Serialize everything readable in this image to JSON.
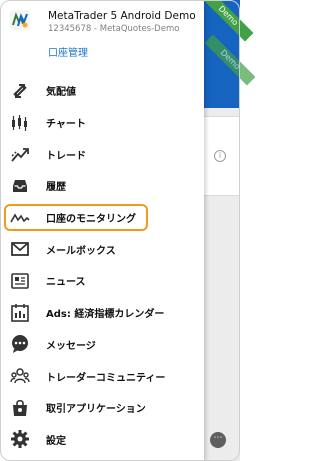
{
  "account": {
    "name": "MetaTrader 5 Android Demo",
    "subtitle": "12345678 - MetaQuotes-Demo",
    "manage_label": "口座管理",
    "badge": "Demo"
  },
  "menu": [
    {
      "label": "気配値",
      "icon": "quotes-icon"
    },
    {
      "label": "チャート",
      "icon": "chart-icon"
    },
    {
      "label": "トレード",
      "icon": "trade-icon"
    },
    {
      "label": "履歴",
      "icon": "history-icon"
    },
    {
      "label": "口座のモニタリング",
      "icon": "monitoring-icon",
      "highlighted": true
    },
    {
      "label": "メールボックス",
      "icon": "mail-icon"
    },
    {
      "label": "ニュース",
      "icon": "news-icon"
    },
    {
      "label": "Ads: 経済指標カレンダー",
      "icon": "calendar-icon"
    },
    {
      "label": "メッセージ",
      "icon": "message-icon"
    },
    {
      "label": "トレーダーコミュニティー",
      "icon": "community-icon"
    },
    {
      "label": "取引アプリケーション",
      "icon": "apps-icon"
    },
    {
      "label": "設定",
      "icon": "settings-icon"
    }
  ],
  "colors": {
    "accent": "#1976d2",
    "highlight": "#f39a1e",
    "badge": "#43a047",
    "icon": "#333333"
  }
}
